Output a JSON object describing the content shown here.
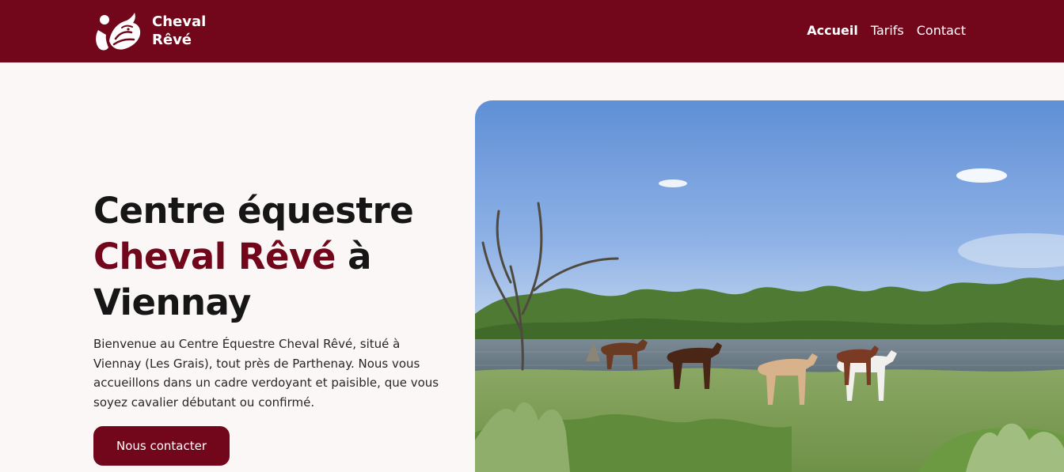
{
  "brand": {
    "name_line1": "Cheval",
    "name_line2": "Rêvé",
    "logo_icon": "horse-head-logo"
  },
  "nav": {
    "items": [
      {
        "label": "Accueil",
        "active": true
      },
      {
        "label": "Tarifs",
        "active": false
      },
      {
        "label": "Contact",
        "active": false
      }
    ]
  },
  "hero": {
    "title_part1": "Centre équestre",
    "title_accent": "Cheval Rêvé",
    "title_part2": "à",
    "title_part3": "Viennay",
    "description": "Bienvenue au Centre Équestre Cheval Rêvé, situé à Viennay (Les Grais), tout près de Parthenay. Nous vous accueillons dans un cadre verdoyant et paisible, que vous soyez cavalier débutant ou confirmé.",
    "cta_label": "Nous contacter",
    "photo": "horses-by-the-lake-photo"
  },
  "colors": {
    "brand": "#72061a",
    "page_background": "#fcf7f7",
    "text": "#161616"
  }
}
